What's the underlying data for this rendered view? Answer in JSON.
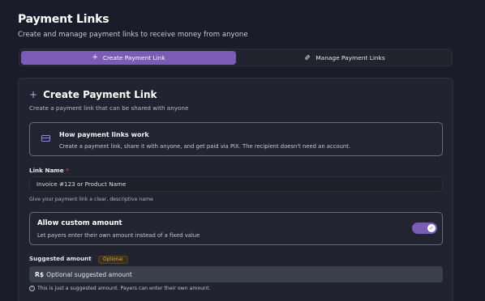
{
  "header": {
    "title": "Payment Links",
    "subtitle": "Create and manage payment links to receive money from anyone"
  },
  "tabs": [
    {
      "label": "Create Payment Link",
      "icon": "plus-icon",
      "active": true
    },
    {
      "label": "Manage Payment Links",
      "icon": "link-icon",
      "active": false
    }
  ],
  "card": {
    "title": "Create Payment Link",
    "subtitle": "Create a payment link that can be shared with anyone",
    "info": {
      "title": "How payment links work",
      "text": "Create a payment link, share it with anyone, and get paid via PIX. The recipient doesn't need an account.",
      "icon": "card-icon"
    },
    "link_name": {
      "label": "Link Name",
      "required_marker": "*",
      "placeholder": "Invoice #123 or Product Name",
      "hint": "Give your payment link a clear, descriptive name"
    },
    "custom_amount": {
      "title": "Allow custom amount",
      "text": "Let payers enter their own amount instead of a fixed value",
      "enabled": true,
      "check": "✓"
    },
    "suggested_amount": {
      "label": "Suggested amount",
      "badge": "Optional",
      "currency": "R$",
      "placeholder": "Optional suggested amount",
      "hint": "This is just a suggested amount. Payers can enter their own amount.",
      "hint_icon": "info-icon"
    }
  },
  "colors": {
    "background": "#1a1d29",
    "accent": "#7a5bb6",
    "badge": "#e8a53a",
    "required": "#e0566a"
  }
}
